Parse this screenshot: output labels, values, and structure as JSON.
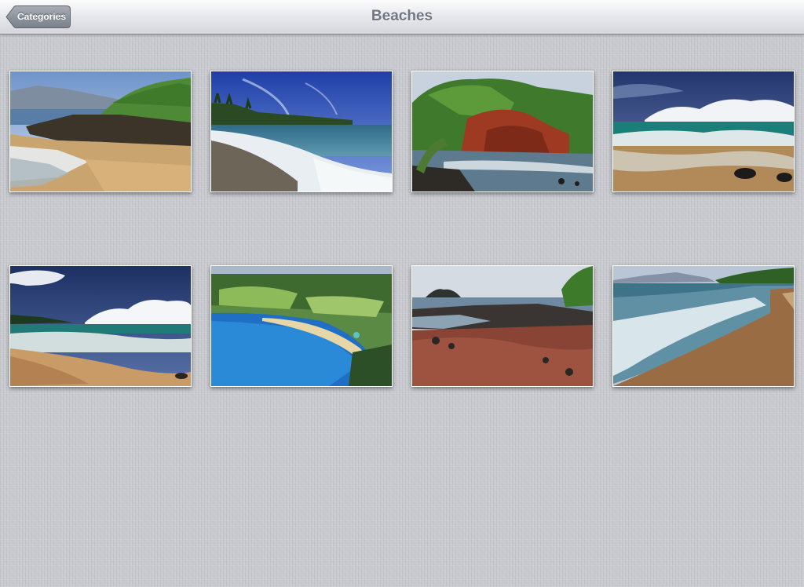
{
  "navbar": {
    "title": "Beaches",
    "back_label": "Categories"
  },
  "photos": [
    {
      "scene": "beach-headland"
    },
    {
      "scene": "surf-palms"
    },
    {
      "scene": "red-cliff"
    },
    {
      "scene": "cloudy-surf"
    },
    {
      "scene": "sand-clouds"
    },
    {
      "scene": "aerial-bay"
    },
    {
      "scene": "red-sand-rocks"
    },
    {
      "scene": "foam-shore"
    }
  ],
  "colors": {
    "background": "#c7c9ce",
    "nav_title": "#707782",
    "back_button": "#8e949d"
  }
}
